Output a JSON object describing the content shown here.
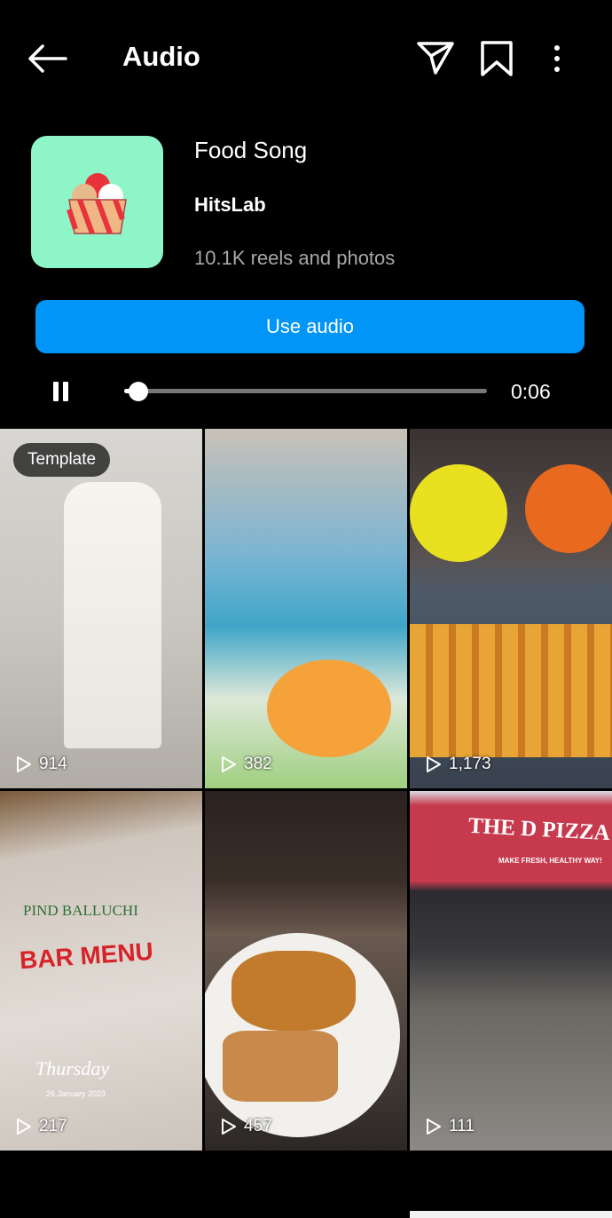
{
  "header": {
    "title": "Audio",
    "icons": [
      "arrow-left-icon",
      "send-icon",
      "bookmark-icon",
      "more-vertical-icon"
    ]
  },
  "audio": {
    "song": "Food Song",
    "artist": "HitsLab",
    "count": "10.1K reels and photos",
    "use_label": "Use audio",
    "time": "0:06",
    "progress": 0.04,
    "playing": true,
    "cover_color": "#8ef5c8"
  },
  "colors": {
    "accent": "#0095f6"
  },
  "grid": [
    {
      "views": "914",
      "badge": "Template"
    },
    {
      "views": "382"
    },
    {
      "views": "1,173"
    },
    {
      "views": "217",
      "photo_text": [
        "PIND BALLUCHI",
        "BAR MENU",
        "Thursday",
        "26 January 2023"
      ]
    },
    {
      "views": "457"
    },
    {
      "views": "111",
      "photo_text": [
        "THE D PIZZA",
        "MAKE FRESH, HEALTHY WAY!"
      ]
    }
  ]
}
